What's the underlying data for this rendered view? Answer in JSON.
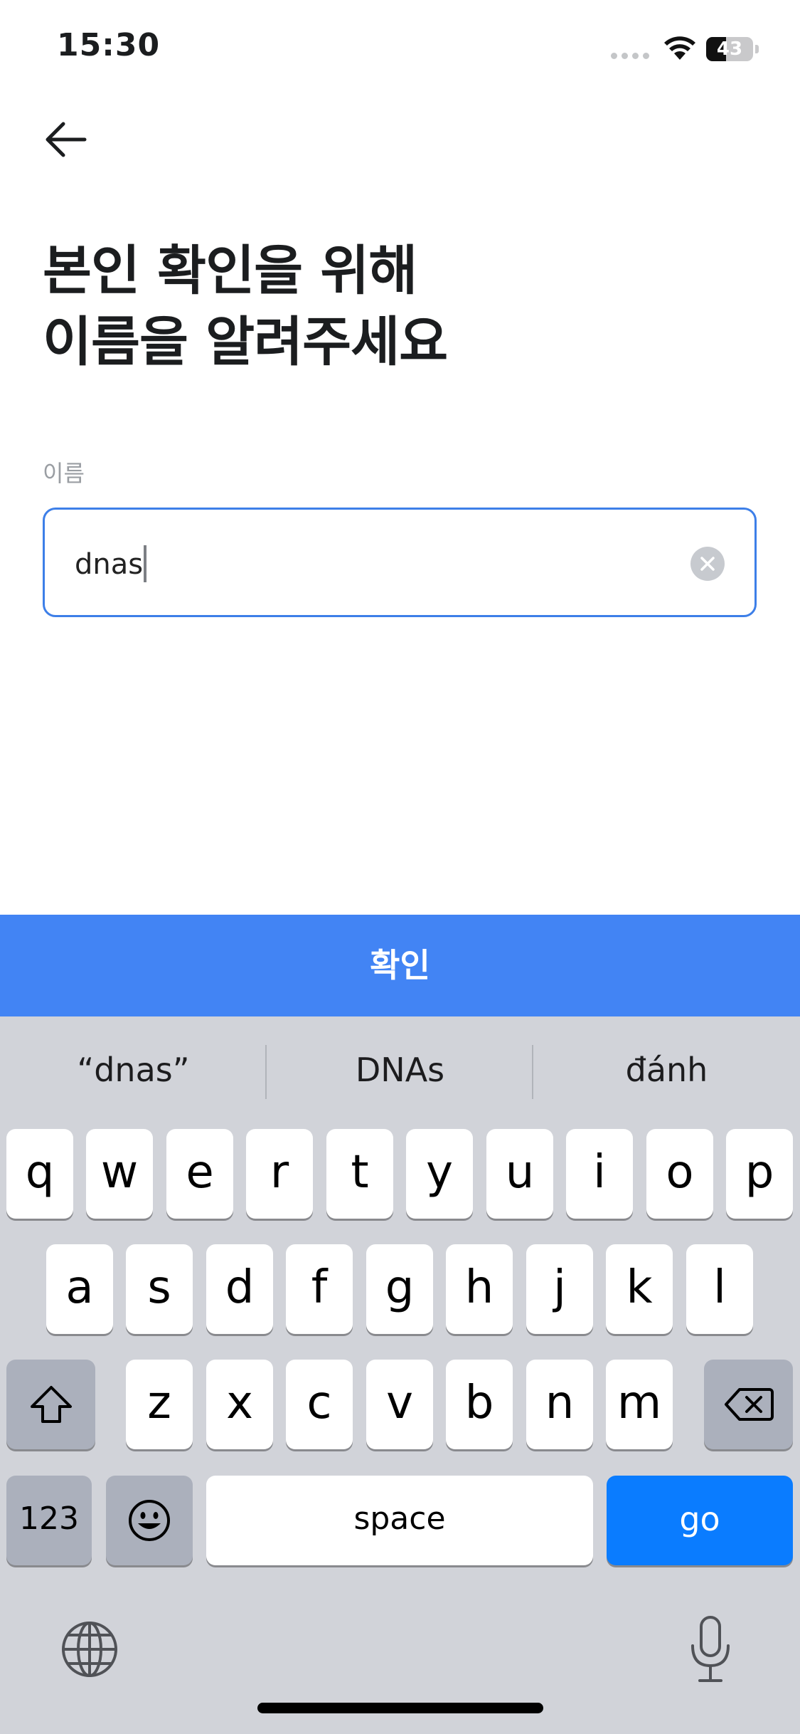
{
  "status_bar": {
    "time": "15:30",
    "battery_level": "43",
    "battery_fraction": 0.43
  },
  "header": {
    "back_icon": "arrow-left-icon"
  },
  "main": {
    "title_line1": "본인 확인을 위해",
    "title_line2": "이름을 알려주세요",
    "name_label": "이름",
    "name_value": "dnas",
    "clear_icon": "clear-x-icon",
    "accent_color": "#3d7fe8"
  },
  "confirm_button": {
    "label": "확인",
    "color": "#4284f4"
  },
  "keyboard": {
    "suggestions": [
      "“dnas”",
      "DNAs",
      "đánh"
    ],
    "row1": [
      "q",
      "w",
      "e",
      "r",
      "t",
      "y",
      "u",
      "i",
      "o",
      "p"
    ],
    "row2": [
      "a",
      "s",
      "d",
      "f",
      "g",
      "h",
      "j",
      "k",
      "l"
    ],
    "row3": [
      "z",
      "x",
      "c",
      "v",
      "b",
      "n",
      "m"
    ],
    "numbers_label": "123",
    "space_label": "space",
    "go_label": "go",
    "go_color": "#0a7cff",
    "shift_icon": "shift-icon",
    "delete_icon": "backspace-icon",
    "emoji_icon": "emoji-icon",
    "globe_icon": "globe-icon",
    "mic_icon": "microphone-icon"
  }
}
